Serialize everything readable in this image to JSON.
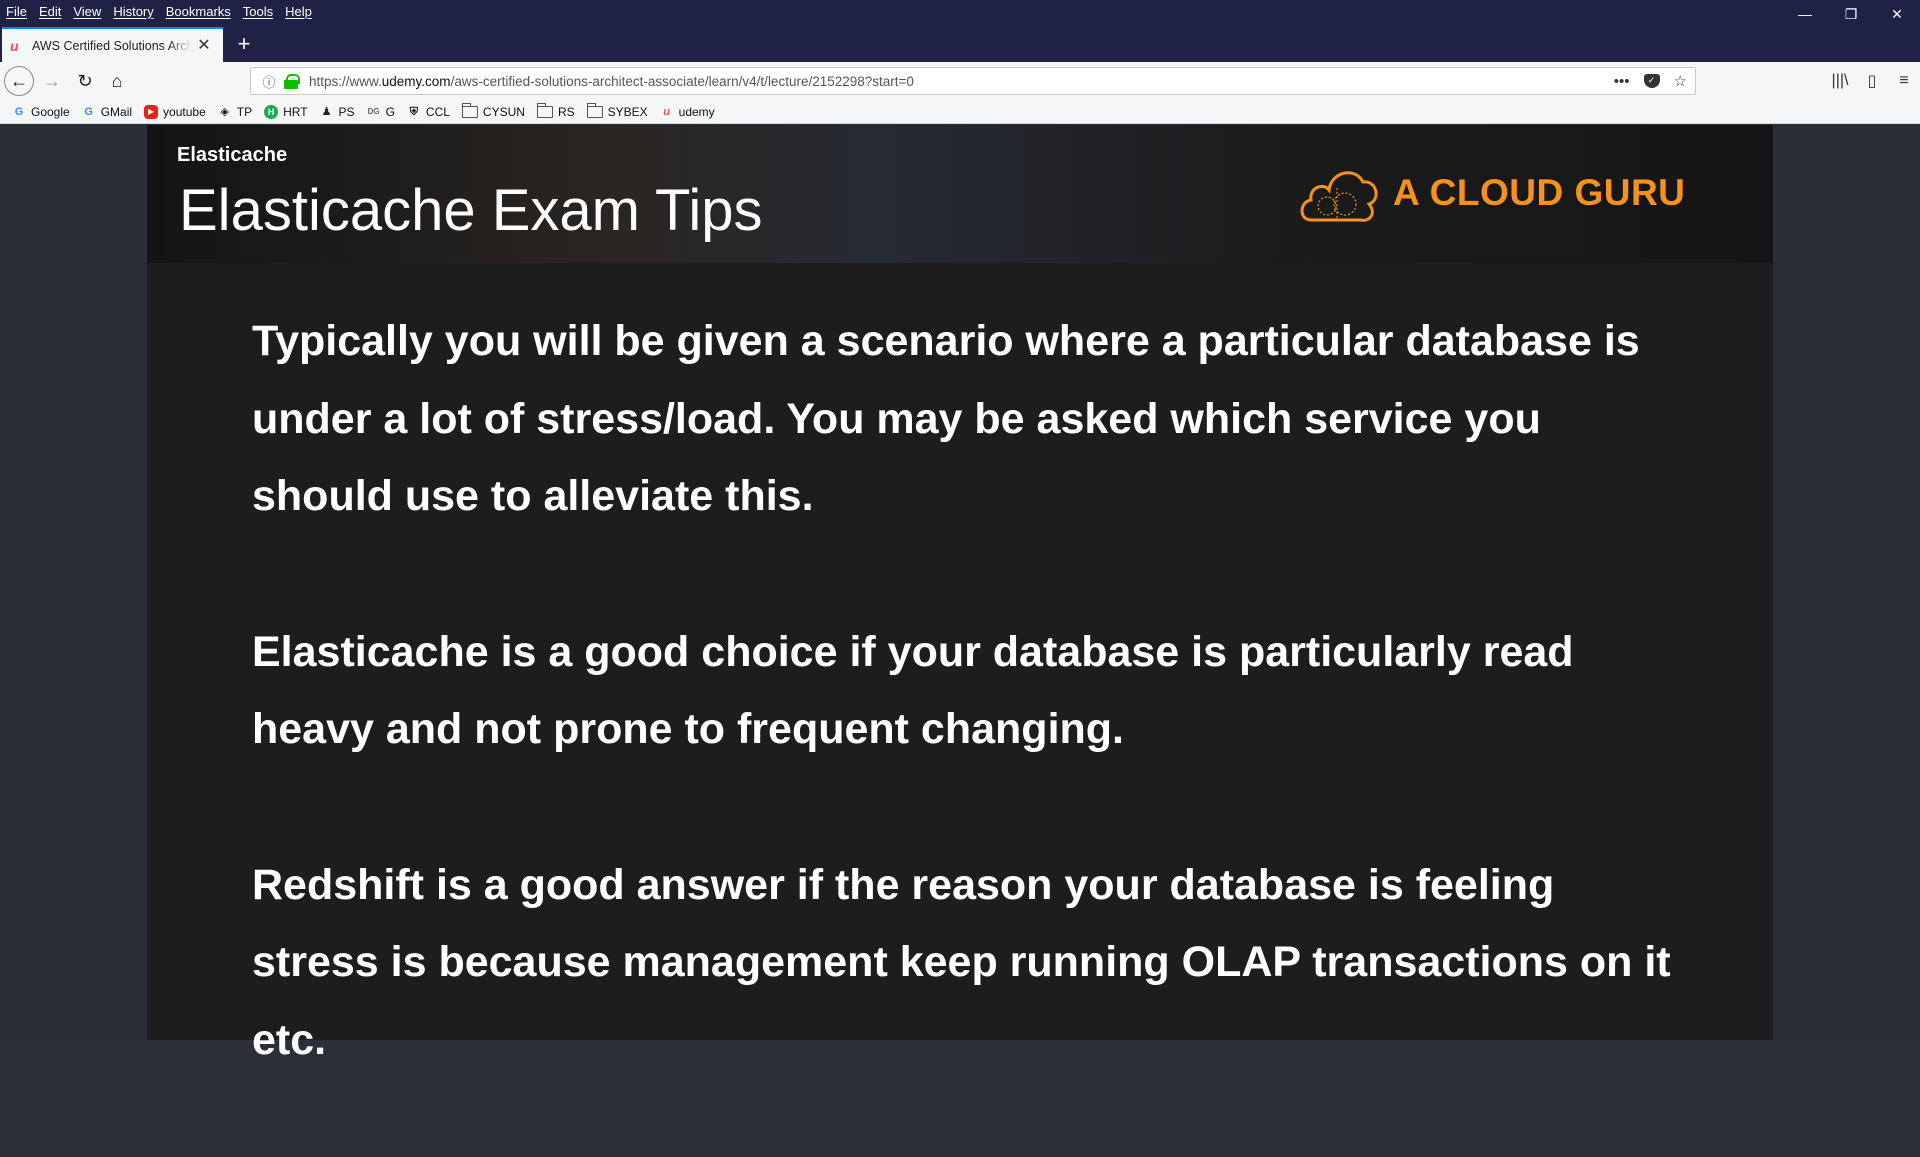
{
  "menu": [
    "File",
    "Edit",
    "View",
    "History",
    "Bookmarks",
    "Tools",
    "Help"
  ],
  "window_controls": {
    "minimize": "—",
    "restore": "❐",
    "close": "✕"
  },
  "tab": {
    "title": "AWS Certified Solutions Architect",
    "favicon": "u",
    "close": "✕",
    "new_tab": "+"
  },
  "nav": {
    "back": "←",
    "forward": "→",
    "reload": "↻",
    "home": "⌂",
    "url_prefix": "https://www.",
    "url_domain": "udemy.com",
    "url_path": "/aws-certified-solutions-architect-associate/learn/v4/t/lecture/2152298?start=0",
    "page_actions": "•••",
    "bookmark_star": "☆",
    "library": "|||\\",
    "sidebar": "▯",
    "menu": "≡"
  },
  "bookmarks": [
    {
      "label": "Google",
      "icon": "G"
    },
    {
      "label": "GMail",
      "icon": "G"
    },
    {
      "label": "youtube",
      "icon": "▶"
    },
    {
      "label": "TP",
      "icon": "◈"
    },
    {
      "label": "HRT",
      "icon": "H"
    },
    {
      "label": "PS",
      "icon": "♟"
    },
    {
      "label": "G",
      "icon": "DG"
    },
    {
      "label": "CCL",
      "icon": "⛨"
    },
    {
      "label": "CYSUN",
      "icon": "folder"
    },
    {
      "label": "RS",
      "icon": "folder"
    },
    {
      "label": "SYBEX",
      "icon": "folder"
    },
    {
      "label": "udemy",
      "icon": "u"
    }
  ],
  "slide": {
    "section": "Elasticache",
    "title": "Elasticache Exam Tips",
    "logo_text": "A CLOUD GURU",
    "logo_color": "#f7911e",
    "paragraphs": [
      "Typically you will be given a scenario where a particular database is under a lot of stress/load. You may be asked which service you should use to alleviate this.",
      "Elasticache is a good choice if your database is particularly read heavy and not prone to frequent changing.",
      "Redshift is a good answer if the reason your database is feeling stress is because management keep running OLAP transactions on it etc."
    ]
  }
}
